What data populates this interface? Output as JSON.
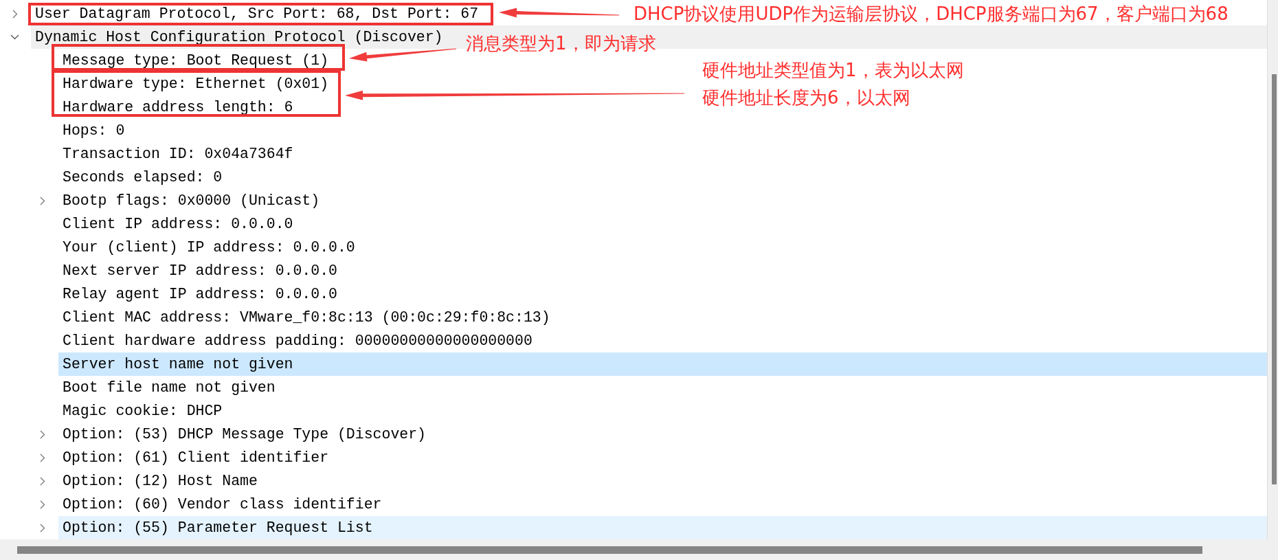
{
  "tree": [
    {
      "label": "User Datagram Protocol, Src Port: 68, Dst Port: 67",
      "expanded": false,
      "selected": false,
      "hovered": false
    },
    {
      "label": "Dynamic Host Configuration Protocol (Discover)",
      "expanded": true,
      "selected": false,
      "hovered": false,
      "children": [
        {
          "label": "Message type: Boot Request (1)",
          "selected": false,
          "hovered": false
        },
        {
          "label": "Hardware type: Ethernet (0x01)",
          "selected": false,
          "hovered": false
        },
        {
          "label": "Hardware address length: 6",
          "selected": false,
          "hovered": false
        },
        {
          "label": "Hops: 0",
          "selected": false,
          "hovered": false
        },
        {
          "label": "Transaction ID: 0x04a7364f",
          "selected": false,
          "hovered": false
        },
        {
          "label": "Seconds elapsed: 0",
          "selected": false,
          "hovered": false
        },
        {
          "label": "Bootp flags: 0x0000 (Unicast)",
          "expanded": false,
          "selected": false,
          "hovered": false
        },
        {
          "label": "Client IP address: 0.0.0.0",
          "selected": false,
          "hovered": false
        },
        {
          "label": "Your (client) IP address: 0.0.0.0",
          "selected": false,
          "hovered": false
        },
        {
          "label": "Next server IP address: 0.0.0.0",
          "selected": false,
          "hovered": false
        },
        {
          "label": "Relay agent IP address: 0.0.0.0",
          "selected": false,
          "hovered": false
        },
        {
          "label": "Client MAC address: VMware_f0:8c:13 (00:0c:29:f0:8c:13)",
          "selected": false,
          "hovered": false
        },
        {
          "label": "Client hardware address padding: 00000000000000000000",
          "selected": false,
          "hovered": false
        },
        {
          "label": "Server host name not given",
          "selected": true,
          "hovered": false
        },
        {
          "label": "Boot file name not given",
          "selected": false,
          "hovered": false
        },
        {
          "label": "Magic cookie: DHCP",
          "selected": false,
          "hovered": false
        },
        {
          "label": "Option: (53) DHCP Message Type (Discover)",
          "expanded": false,
          "selected": false,
          "hovered": false
        },
        {
          "label": "Option: (61) Client identifier",
          "expanded": false,
          "selected": false,
          "hovered": false
        },
        {
          "label": "Option: (12) Host Name",
          "expanded": false,
          "selected": false,
          "hovered": false
        },
        {
          "label": "Option: (60) Vendor class identifier",
          "expanded": false,
          "selected": false,
          "hovered": false
        },
        {
          "label": "Option: (55) Parameter Request List",
          "expanded": false,
          "selected": false,
          "hovered": true
        }
      ]
    }
  ],
  "annotations": [
    {
      "lines": [
        "DHCP协议使用UDP作为运输层协议，DHCP服务端口为67，客户端口为68"
      ]
    },
    {
      "lines": [
        "消息类型为1，即为请求"
      ]
    },
    {
      "lines": [
        "硬件地址类型值为1，表为以太网",
        "硬件地址长度为6，以太网"
      ]
    }
  ]
}
